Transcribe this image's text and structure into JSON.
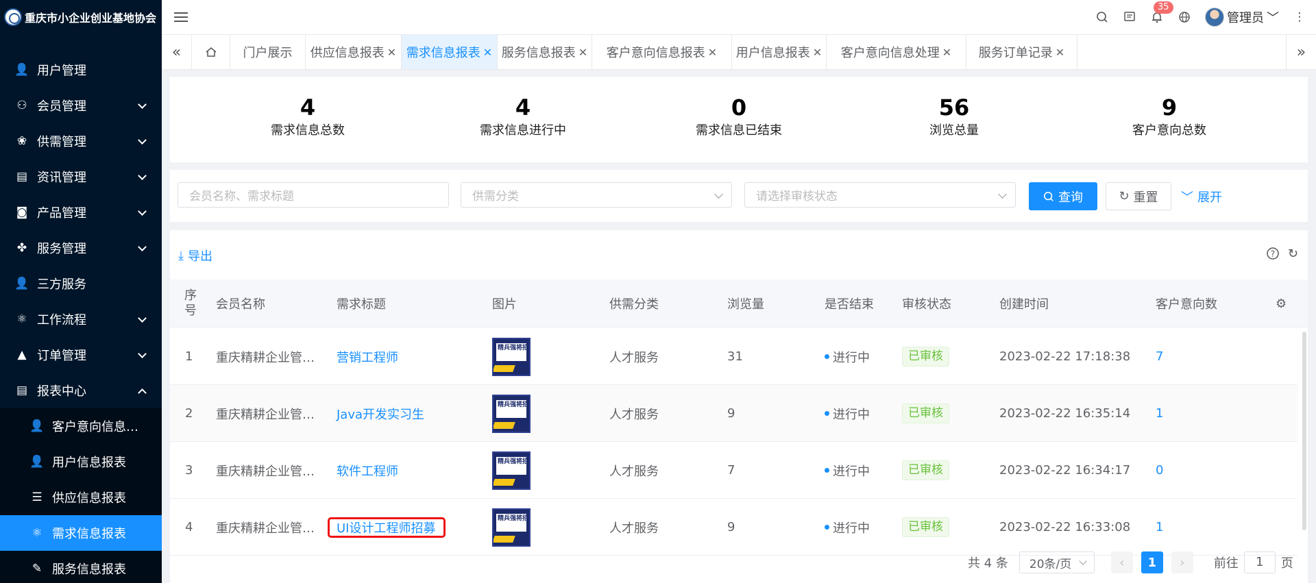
{
  "app": {
    "title": "重庆市小企业创业基地协会"
  },
  "sidebar": {
    "items": [
      {
        "label": "用户管理",
        "icon": "user-icon"
      },
      {
        "label": "会员管理",
        "icon": "members-icon"
      },
      {
        "label": "供需管理",
        "icon": "supply-icon"
      },
      {
        "label": "资讯管理",
        "icon": "news-icon"
      },
      {
        "label": "产品管理",
        "icon": "product-icon"
      },
      {
        "label": "服务管理",
        "icon": "service-icon"
      },
      {
        "label": "三方服务",
        "icon": "third-party-icon"
      },
      {
        "label": "工作流程",
        "icon": "workflow-icon"
      },
      {
        "label": "订单管理",
        "icon": "order-icon"
      },
      {
        "label": "报表中心",
        "icon": "report-icon"
      }
    ],
    "sub_items": [
      {
        "label": "客户意向信息…"
      },
      {
        "label": "用户信息报表"
      },
      {
        "label": "供应信息报表"
      },
      {
        "label": "需求信息报表"
      },
      {
        "label": "服务信息报表"
      }
    ]
  },
  "header": {
    "notification_count": "35",
    "user_name": "管理员"
  },
  "tabs": [
    {
      "label": "门户展示"
    },
    {
      "label": "供应信息报表"
    },
    {
      "label": "需求信息报表"
    },
    {
      "label": "服务信息报表"
    },
    {
      "label": "客户意向信息报表"
    },
    {
      "label": "用户信息报表"
    },
    {
      "label": "客户意向信息处理"
    },
    {
      "label": "服务订单记录"
    }
  ],
  "stats": [
    {
      "value": "4",
      "label": "需求信息总数"
    },
    {
      "value": "4",
      "label": "需求信息进行中"
    },
    {
      "value": "0",
      "label": "需求信息已结束"
    },
    {
      "value": "56",
      "label": "浏览总量"
    },
    {
      "value": "9",
      "label": "客户意向总数"
    }
  ],
  "filter": {
    "keyword_placeholder": "会员名称、需求标题",
    "category_placeholder": "供需分类",
    "status_placeholder": "请选择审核状态",
    "search_label": "查询",
    "reset_label": "重置",
    "expand_label": "展开"
  },
  "table": {
    "export_label": "导出",
    "headers": {
      "index": "序号",
      "member": "会员名称",
      "title": "需求标题",
      "image": "图片",
      "category": "供需分类",
      "views": "浏览量",
      "ended": "是否结束",
      "audit": "审核状态",
      "created": "创建时间",
      "intents": "客户意向数"
    },
    "thumb_text": "精兵强将招募令",
    "rows": [
      {
        "index": "1",
        "member": "重庆精耕企业管…",
        "title": "营销工程师",
        "category": "人才服务",
        "views": "31",
        "ended": "进行中",
        "audit": "已审核",
        "created": "2023-02-22 17:18:38",
        "intents": "7"
      },
      {
        "index": "2",
        "member": "重庆精耕企业管…",
        "title": "Java开发实习生",
        "category": "人才服务",
        "views": "9",
        "ended": "进行中",
        "audit": "已审核",
        "created": "2023-02-22 16:35:14",
        "intents": "1"
      },
      {
        "index": "3",
        "member": "重庆精耕企业管…",
        "title": "软件工程师",
        "category": "人才服务",
        "views": "7",
        "ended": "进行中",
        "audit": "已审核",
        "created": "2023-02-22 16:34:17",
        "intents": "0"
      },
      {
        "index": "4",
        "member": "重庆精耕企业管…",
        "title": "UI设计工程师招募",
        "category": "人才服务",
        "views": "9",
        "ended": "进行中",
        "audit": "已审核",
        "created": "2023-02-22 16:33:08",
        "intents": "1"
      }
    ]
  },
  "pagination": {
    "total": "共 4 条",
    "page_size": "20条/页",
    "current_page": "1",
    "goto_label": "前往",
    "goto_value": "1",
    "page_unit": "页"
  }
}
